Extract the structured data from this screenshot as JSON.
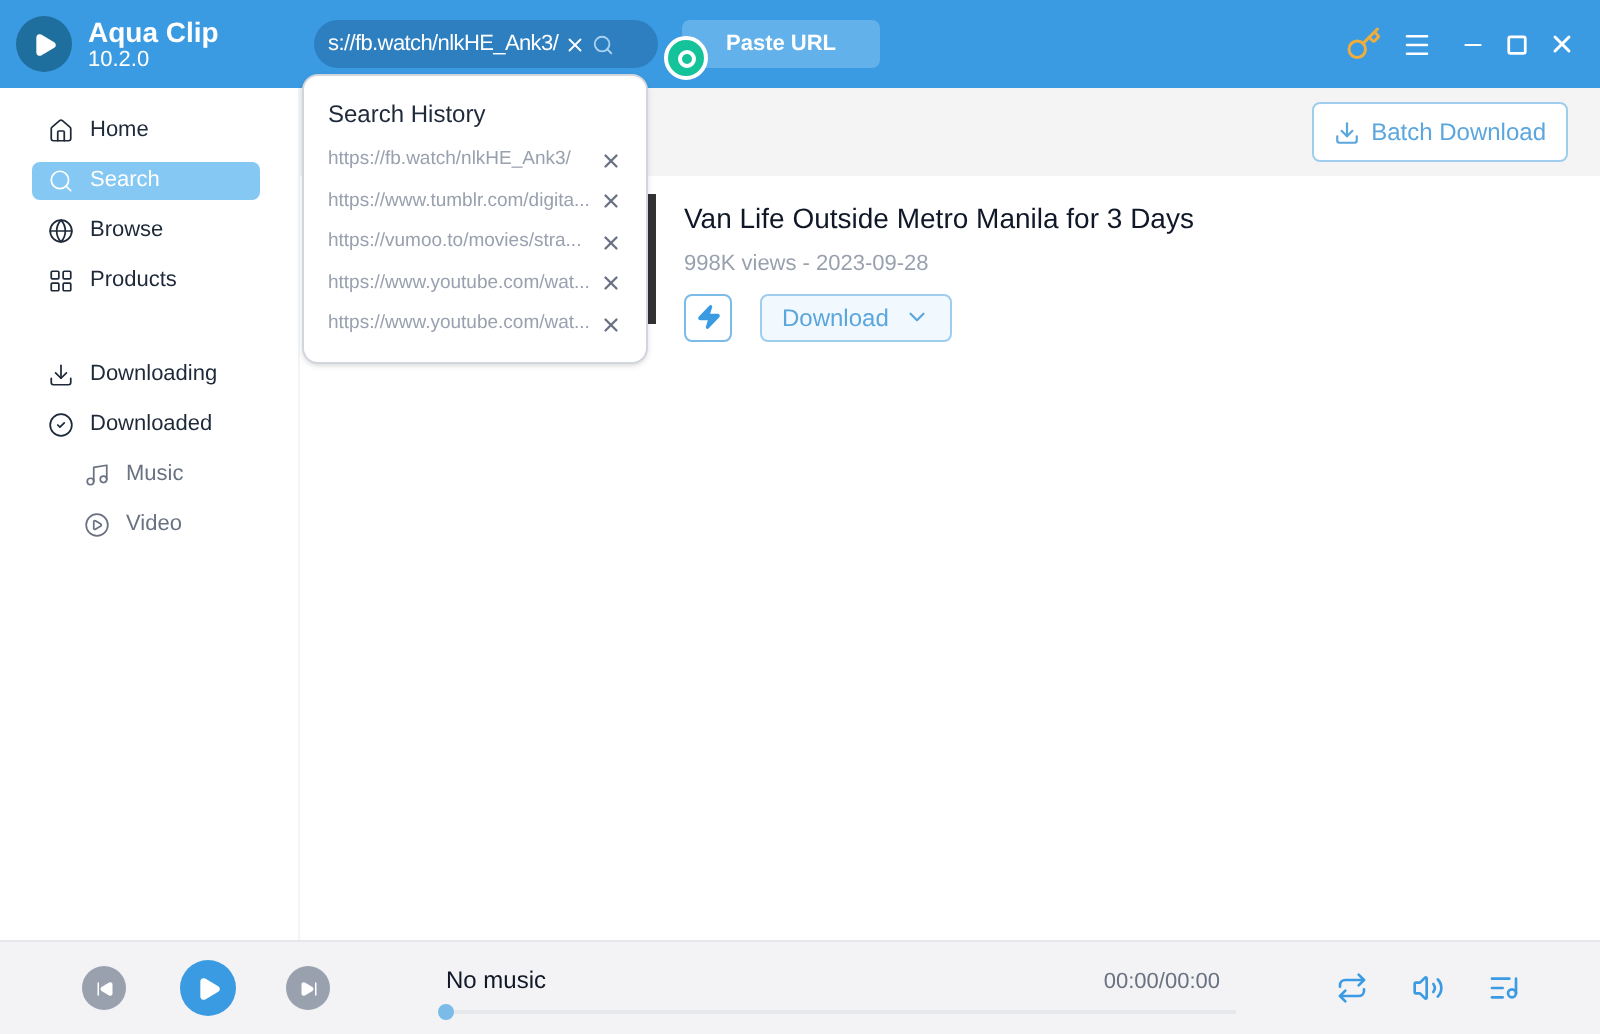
{
  "app": {
    "name": "Aqua Clip",
    "version": "10.2.0"
  },
  "search": {
    "value": "s://fb.watch/nlkHE_Ank3/"
  },
  "paste_button": "Paste URL",
  "history": {
    "title": "Search History",
    "items": [
      "https://fb.watch/nlkHE_Ank3/",
      "https://www.tumblr.com/digita...",
      "https://vumoo.to/movies/stra...",
      "https://www.youtube.com/wat...",
      "https://www.youtube.com/wat..."
    ]
  },
  "sidebar": {
    "items": [
      {
        "label": "Home",
        "selected": false
      },
      {
        "label": "Search",
        "selected": true
      },
      {
        "label": "Browse",
        "selected": false
      },
      {
        "label": "Products",
        "selected": false
      },
      {
        "label": "Downloading",
        "selected": false
      },
      {
        "label": "Downloaded",
        "selected": false,
        "children": [
          {
            "label": "Music",
            "selected": false
          },
          {
            "label": "Video",
            "selected": false
          }
        ]
      }
    ]
  },
  "batch_button": "Batch Download",
  "video": {
    "title": "Van Life Outside Metro Manila for 3 Days",
    "meta": "998K views - 2023-09-28",
    "download_button": "Download"
  },
  "player": {
    "track": "No music",
    "time": "00:00/00:00",
    "level": 0
  }
}
